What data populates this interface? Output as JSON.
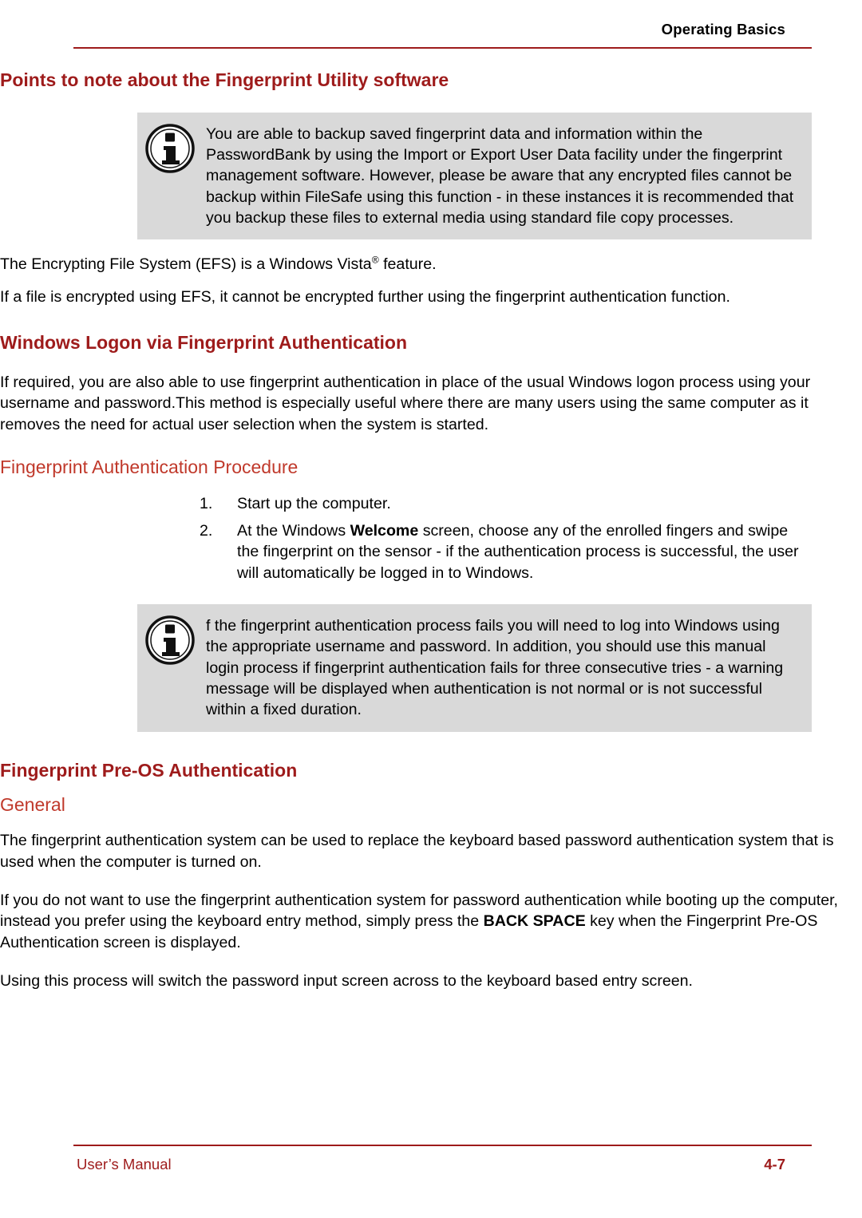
{
  "header": {
    "section_label": "Operating Basics"
  },
  "footer": {
    "left": "User’s Manual",
    "right": "4-7"
  },
  "colors": {
    "heading_red": "#9e1b1b",
    "subheading_red": "#c0392b",
    "note_background": "#d9d9d9",
    "rule": "#9e1b1b"
  },
  "content": {
    "h1_points": "Points to note about the Fingerprint Utility software",
    "note1": "You are able to backup saved fingerprint data and information within the PasswordBank by using the Import or Export User Data facility under the fingerprint management software. However, please be aware that any encrypted files cannot be backup within FileSafe using this function - in these instances it is recommended that you backup these files to external media using standard file copy processes.",
    "p_efs_1a": "The Encrypting File System (EFS) is a Windows Vista",
    "p_efs_1sup": "®",
    "p_efs_1b": " feature.",
    "p_efs_2": "If a file is encrypted using EFS, it cannot be encrypted further using the fingerprint authentication function.",
    "h1_windows_logon": "Windows Logon via Fingerprint Authentication",
    "p_windows_logon": "If required, you are also able to use fingerprint authentication in place of the usual Windows logon process using your username and password.This method is especially useful where there are many users using the same computer as it removes the need for actual user selection when the system is started.",
    "h2_auth_procedure": "Fingerprint Authentication Procedure",
    "steps": [
      {
        "num": "1.",
        "text_a": "Start up the computer.",
        "bold": "",
        "text_b": ""
      },
      {
        "num": "2.",
        "text_a": "At the Windows ",
        "bold": "Welcome",
        "text_b": " screen, choose any of the enrolled fingers and swipe the fingerprint on the sensor - if the authentication process is successful, the user will automatically be logged in to Windows."
      }
    ],
    "note2": "f the fingerprint authentication process fails you will need to log into Windows using the appropriate username and password. In addition, you should use this manual login process if fingerprint authentication fails for three consecutive tries - a warning message will be displayed when authentication is not normal or is not successful within a fixed duration.",
    "h1_preos": "Fingerprint Pre-OS Authentication",
    "h2_general": "General",
    "p_general_1": "The fingerprint authentication system can be used to replace the keyboard based password authentication system that is used when the computer is turned on.",
    "p_general_2a": "If you do not want to use the fingerprint authentication system for password authentication while booting up the computer, instead you prefer using the keyboard entry method, simply press the ",
    "p_general_2bold": "BACK SPACE",
    "p_general_2b": " key when the Fingerprint Pre-OS Authentication screen is displayed.",
    "p_general_3": "Using this process will switch the password input screen across to the keyboard based entry screen."
  },
  "icons": {
    "note": "info-icon"
  }
}
